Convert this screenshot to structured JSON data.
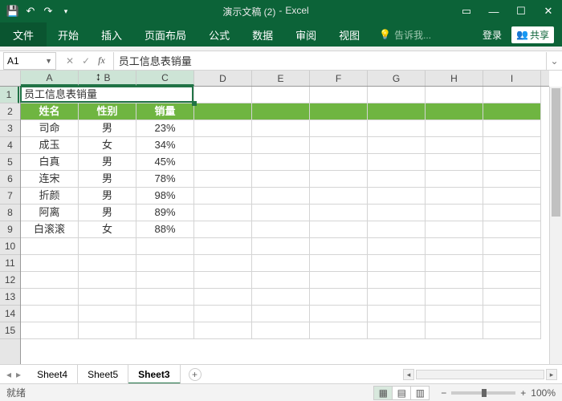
{
  "app": {
    "doc_title": "演示文稿 (2)",
    "app_name": "Excel"
  },
  "ribbon": {
    "file": "文件",
    "tabs": [
      "开始",
      "插入",
      "页面布局",
      "公式",
      "数据",
      "审阅",
      "视图"
    ],
    "tellme_icon": "lightbulb-icon",
    "tellme": "告诉我...",
    "signin": "登录",
    "share": "共享"
  },
  "formula": {
    "namebox": "A1",
    "value": "员工信息表销量"
  },
  "columns": [
    "A",
    "B",
    "C",
    "D",
    "E",
    "F",
    "G",
    "H",
    "I"
  ],
  "selected_cols": [
    "A",
    "B",
    "C"
  ],
  "selected_row": 1,
  "row_count": 15,
  "title_cell": "员工信息表销量",
  "headers": [
    "姓名",
    "性别",
    "销量"
  ],
  "data_rows": [
    [
      "司命",
      "男",
      "23%"
    ],
    [
      "成玉",
      "女",
      "34%"
    ],
    [
      "白真",
      "男",
      "45%"
    ],
    [
      "连宋",
      "男",
      "78%"
    ],
    [
      "折颜",
      "男",
      "98%"
    ],
    [
      "阿离",
      "男",
      "89%"
    ],
    [
      "白滚滚",
      "女",
      "88%"
    ]
  ],
  "sheets": {
    "tabs": [
      "Sheet4",
      "Sheet5",
      "Sheet3"
    ],
    "active": "Sheet3"
  },
  "status": {
    "ready": "就绪",
    "zoom": "100%"
  },
  "colors": {
    "ribbon": "#0c6338",
    "header_fill": "#6fb541",
    "selection": "#217346"
  }
}
